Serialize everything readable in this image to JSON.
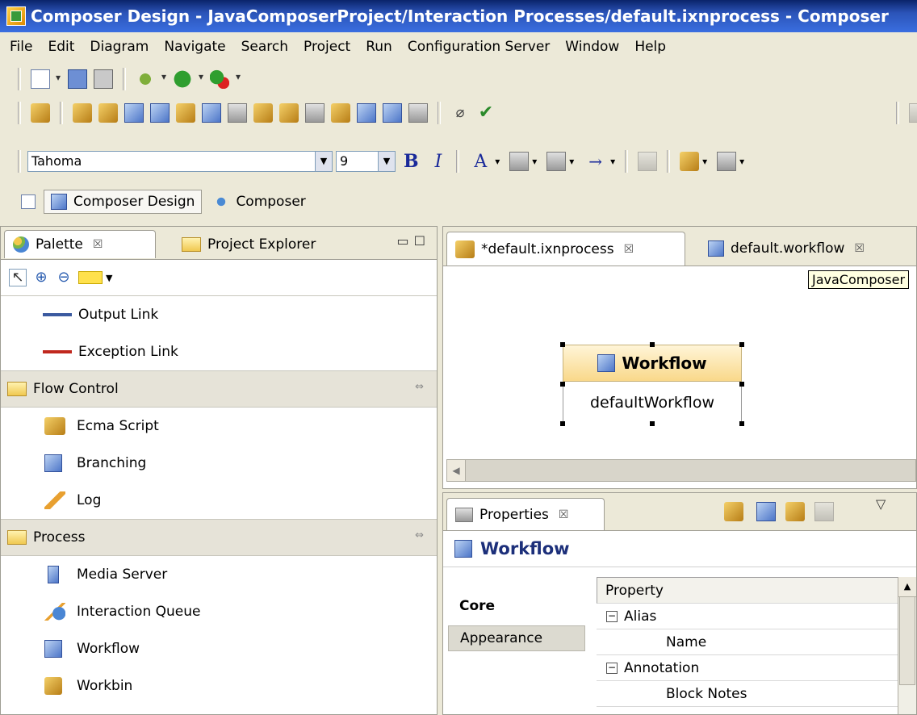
{
  "window": {
    "title": "Composer Design - JavaComposerProject/Interaction Processes/default.ixnprocess - Composer"
  },
  "menu": [
    "File",
    "Edit",
    "Diagram",
    "Navigate",
    "Search",
    "Project",
    "Run",
    "Configuration Server",
    "Window",
    "Help"
  ],
  "font_toolbar": {
    "font_name": "Tahoma",
    "font_size": "9",
    "bold": "B",
    "italic": "I",
    "font_color": "A",
    "arrow": "→"
  },
  "perspectives": {
    "design": "Composer Design",
    "composer": "Composer"
  },
  "palette_view": {
    "tabs": {
      "palette": "Palette",
      "project_explorer": "Project Explorer",
      "close": "☒"
    },
    "items_top": [
      {
        "label": "Output Link"
      },
      {
        "label": "Exception Link"
      }
    ],
    "flow_control": {
      "label": "Flow Control",
      "items": [
        {
          "label": "Ecma Script"
        },
        {
          "label": "Branching"
        },
        {
          "label": "Log"
        }
      ]
    },
    "process": {
      "label": "Process",
      "items": [
        {
          "label": "Media Server"
        },
        {
          "label": "Interaction Queue"
        },
        {
          "label": "Workflow"
        },
        {
          "label": "Workbin"
        }
      ]
    }
  },
  "editor": {
    "tabs": {
      "ixnprocess": "*default.ixnprocess",
      "workflow": "default.workflow",
      "close": "☒"
    },
    "tooltip": "JavaComposer",
    "node": {
      "title": "Workflow",
      "name": "defaultWorkflow"
    }
  },
  "properties": {
    "tab_label": "Properties",
    "close": "☒",
    "title": "Workflow",
    "side_tabs": {
      "core": "Core",
      "appearance": "Appearance"
    },
    "table": {
      "header": "Property",
      "rows": [
        {
          "label": "Alias",
          "group": true,
          "expander": "−"
        },
        {
          "label": "Name",
          "group": false
        },
        {
          "label": "Annotation",
          "group": true,
          "expander": "−"
        },
        {
          "label": "Block Notes",
          "group": false
        }
      ]
    }
  }
}
